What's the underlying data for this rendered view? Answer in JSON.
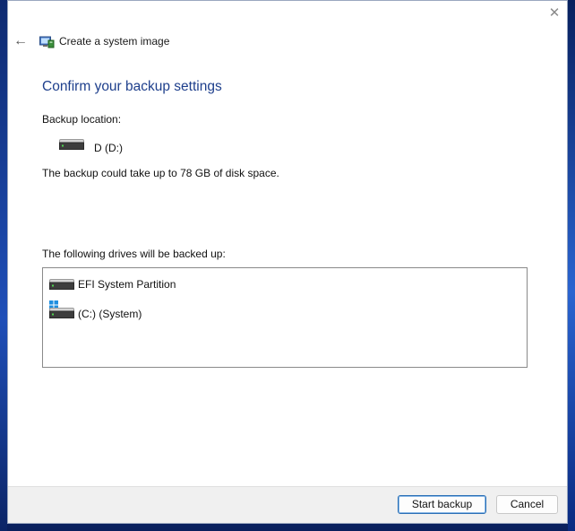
{
  "window": {
    "title": "Create a system image",
    "close_glyph": "✕",
    "back_glyph": "←"
  },
  "main": {
    "heading": "Confirm your backup settings",
    "backup_location_label": "Backup location:",
    "backup_location_drive": "D (D:)",
    "space_note": "The backup could take up to 78 GB of disk space.",
    "drives_label": "The following drives will be backed up:",
    "drives": [
      {
        "label": "EFI System Partition",
        "icon": "hard-drive-icon"
      },
      {
        "label": "(C:) (System)",
        "icon": "windows-system-drive-icon"
      }
    ]
  },
  "footer": {
    "start_label": "Start backup",
    "cancel_label": "Cancel"
  },
  "colors": {
    "heading": "#1e3f8c",
    "primary_border": "#2a6fb5"
  }
}
